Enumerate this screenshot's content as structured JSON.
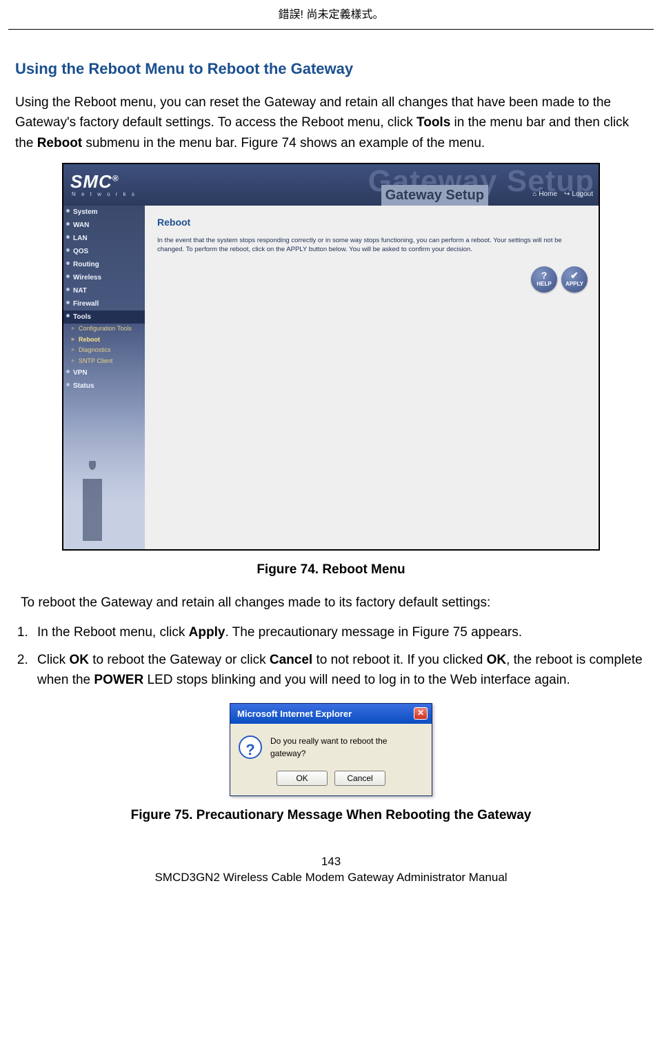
{
  "header": {
    "error_text": "錯誤! 尚未定義樣式。"
  },
  "section": {
    "title": "Using the Reboot Menu to Reboot the Gateway",
    "intro_pre": "Using the Reboot menu, you can reset the Gateway and retain all changes that have been made to the Gateway's factory default settings. To access the Reboot menu, click ",
    "intro_bold1": "Tools",
    "intro_mid": " in the menu bar and then click the ",
    "intro_bold2": "Reboot",
    "intro_post": " submenu in the menu bar. Figure 74 shows an example of the menu."
  },
  "fig74": {
    "caption": "Figure 74. Reboot Menu",
    "brand": "SMC",
    "brand_sub": "N e t w o r k s",
    "ghost": "Gateway Setup",
    "label": "Gateway Setup",
    "links": {
      "home": "Home",
      "logout": "Logout"
    },
    "sidebar": {
      "items": [
        {
          "label": "System"
        },
        {
          "label": "WAN"
        },
        {
          "label": "LAN"
        },
        {
          "label": "QOS"
        },
        {
          "label": "Routing"
        },
        {
          "label": "Wireless"
        },
        {
          "label": "NAT"
        },
        {
          "label": "Firewall"
        },
        {
          "label": "Tools",
          "active": true,
          "subs": [
            {
              "label": "Configuration Tools"
            },
            {
              "label": "Reboot",
              "sel": true
            },
            {
              "label": "Diagnostics"
            },
            {
              "label": "SNTP Client"
            }
          ]
        },
        {
          "label": "VPN"
        },
        {
          "label": "Status"
        }
      ]
    },
    "panel": {
      "title": "Reboot",
      "desc": "In the event that the system stops responding correctly or in some way stops functioning, you can perform a reboot. Your settings will not be changed. To perform the reboot, click on the APPLY button below. You will be asked to confirm your decision.",
      "help": "HELP",
      "apply": "APPLY"
    }
  },
  "body2": {
    "lead": "To reboot the Gateway and retain all changes made to its factory default settings:",
    "steps": [
      {
        "pre": "In the Reboot menu, click ",
        "b1": "Apply",
        "post": ". The precautionary message in Figure 75 appears."
      },
      {
        "pre": "Click ",
        "b1": "OK",
        "mid1": " to reboot the Gateway or click ",
        "b2": "Cancel",
        "mid2": " to not reboot it. If you clicked ",
        "b3": "OK",
        "mid3": ", the reboot is complete when the ",
        "b4": "POWER",
        "post": " LED stops blinking and you will need to log in to the Web interface again."
      }
    ]
  },
  "fig75": {
    "caption": "Figure 75. Precautionary Message When Rebooting the Gateway",
    "title": "Microsoft Internet Explorer",
    "msg": "Do you really want to reboot the gateway?",
    "ok": "OK",
    "cancel": "Cancel"
  },
  "footer": {
    "page": "143",
    "manual": "SMCD3GN2 Wireless Cable Modem Gateway Administrator Manual"
  }
}
